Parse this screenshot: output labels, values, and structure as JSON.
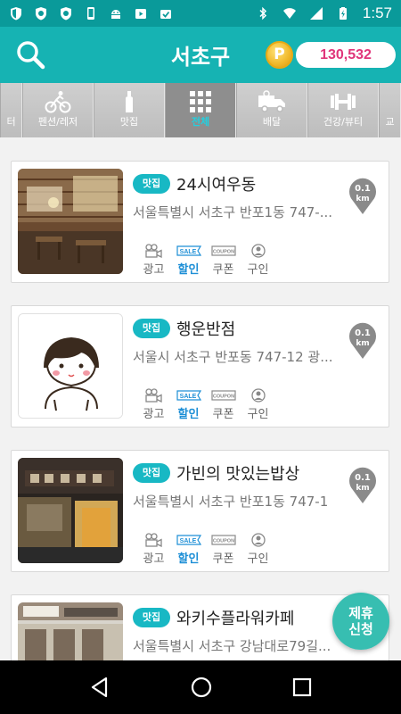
{
  "status_bar": {
    "time": "1:57"
  },
  "header": {
    "title": "서초구",
    "coin_symbol": "P",
    "points": "130,532"
  },
  "categories": [
    {
      "label": "터",
      "icon": "cut-off-icon"
    },
    {
      "label": "펜션/레저",
      "icon": "cyclist-icon"
    },
    {
      "label": "맛집",
      "icon": "bottle-icon"
    },
    {
      "label": "전체",
      "icon": "grid-icon",
      "active": true
    },
    {
      "label": "배달",
      "icon": "delivery-truck-icon"
    },
    {
      "label": "건강/뷰티",
      "icon": "barbell-icon"
    },
    {
      "label": "교",
      "icon": "cut-off-icon"
    }
  ],
  "listings": [
    {
      "tag": "맛집",
      "name": "24시여우동",
      "address": "서울특별시 서초구 반포1동 747-...",
      "distance_value": "0.1",
      "distance_unit": "km"
    },
    {
      "tag": "맛집",
      "name": "행운반점",
      "address": "서울시 서초구 반포동 747-12 광...",
      "distance_value": "0.1",
      "distance_unit": "km"
    },
    {
      "tag": "맛집",
      "name": "가빈의 맛있는밥상",
      "address": "서울특별시 서초구 반포1동 747-1",
      "distance_value": "0.1",
      "distance_unit": "km"
    },
    {
      "tag": "맛집",
      "name": "와키수플라워카페",
      "address": "서울특별시 서초구 강남대로79길...",
      "distance_value": "",
      "distance_unit": ""
    }
  ],
  "badges": {
    "ad": "광고",
    "sale_icon_text": "SALE",
    "sale": "할인",
    "coupon_icon_text": "COUPON",
    "coupon": "쿠폰",
    "hire": "구인"
  },
  "fab": {
    "line1": "제휴",
    "line2": "신청"
  },
  "colors": {
    "header": "#16b3b3",
    "statusbar": "#0a9a9a",
    "tag": "#18b8c4",
    "points_text": "#e0357a",
    "active_badge": "#1e8fd6"
  }
}
